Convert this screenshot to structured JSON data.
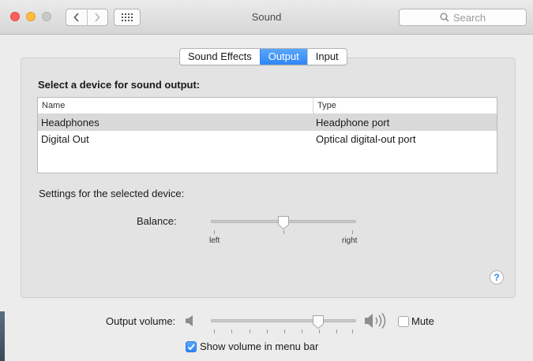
{
  "window": {
    "title": "Sound"
  },
  "toolbar": {
    "search_placeholder": "Search"
  },
  "tabs": [
    {
      "label": "Sound Effects",
      "active": false
    },
    {
      "label": "Output",
      "active": true
    },
    {
      "label": "Input",
      "active": false
    }
  ],
  "output": {
    "heading": "Select a device for sound output:",
    "columns": {
      "name": "Name",
      "type": "Type"
    },
    "devices": [
      {
        "name": "Headphones",
        "type": "Headphone port",
        "selected": true
      },
      {
        "name": "Digital Out",
        "type": "Optical digital-out port",
        "selected": false
      }
    ],
    "settings_label": "Settings for the selected device:",
    "balance": {
      "label": "Balance:",
      "left_label": "left",
      "right_label": "right",
      "value": 0.5
    }
  },
  "help": {
    "label": "?"
  },
  "volume": {
    "label": "Output volume:",
    "value": 0.74,
    "mute_label": "Mute",
    "mute_checked": false,
    "show_in_menu_bar_label": "Show volume in menu bar",
    "show_in_menu_bar_checked": true
  },
  "colors": {
    "accent": "#2f86f6",
    "close": "#fc605c",
    "minimize": "#fdbc40",
    "zoom": "#c9c9c9"
  }
}
